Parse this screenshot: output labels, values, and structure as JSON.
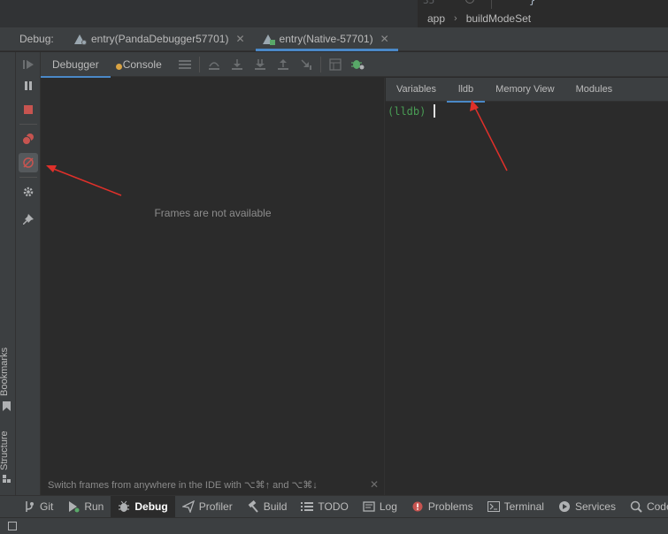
{
  "editor": {
    "line_number": "35",
    "brace": "}",
    "breadcrumbs": [
      "app",
      "buildModeSet"
    ]
  },
  "debug_bar": {
    "label": "Debug:",
    "tabs": [
      {
        "label": "entry(PandaDebugger57701)",
        "active": false
      },
      {
        "label": "entry(Native-57701)",
        "active": true
      }
    ]
  },
  "debugger_tabs": {
    "debugger": "Debugger",
    "console": "Console"
  },
  "frames": {
    "empty_text": "Frames are not available",
    "hint": "Switch frames from anywhere in the IDE with ⌥⌘↑ and ⌥⌘↓"
  },
  "right_tabs": [
    "Variables",
    "lldb",
    "Memory View",
    "Modules"
  ],
  "lldb": {
    "prompt": "(lldb)"
  },
  "side_labels": {
    "bookmarks": "Bookmarks",
    "structure": "Structure"
  },
  "bottom_tools": [
    {
      "label": "Git",
      "icon": "git-branch-icon"
    },
    {
      "label": "Run",
      "icon": "run-icon"
    },
    {
      "label": "Debug",
      "icon": "bug-icon"
    },
    {
      "label": "Profiler",
      "icon": "profiler-icon"
    },
    {
      "label": "Build",
      "icon": "hammer-icon"
    },
    {
      "label": "TODO",
      "icon": "list-icon"
    },
    {
      "label": "Log",
      "icon": "log-icon"
    },
    {
      "label": "Problems",
      "icon": "error-icon"
    },
    {
      "label": "Terminal",
      "icon": "terminal-icon"
    },
    {
      "label": "Services",
      "icon": "services-icon"
    },
    {
      "label": "Code Li",
      "icon": "code-lint-icon"
    }
  ],
  "colors": {
    "accent": "#4a88c7",
    "stop_red": "#c75450",
    "prompt_green": "#499c54",
    "annotation_red": "#e0302a"
  }
}
